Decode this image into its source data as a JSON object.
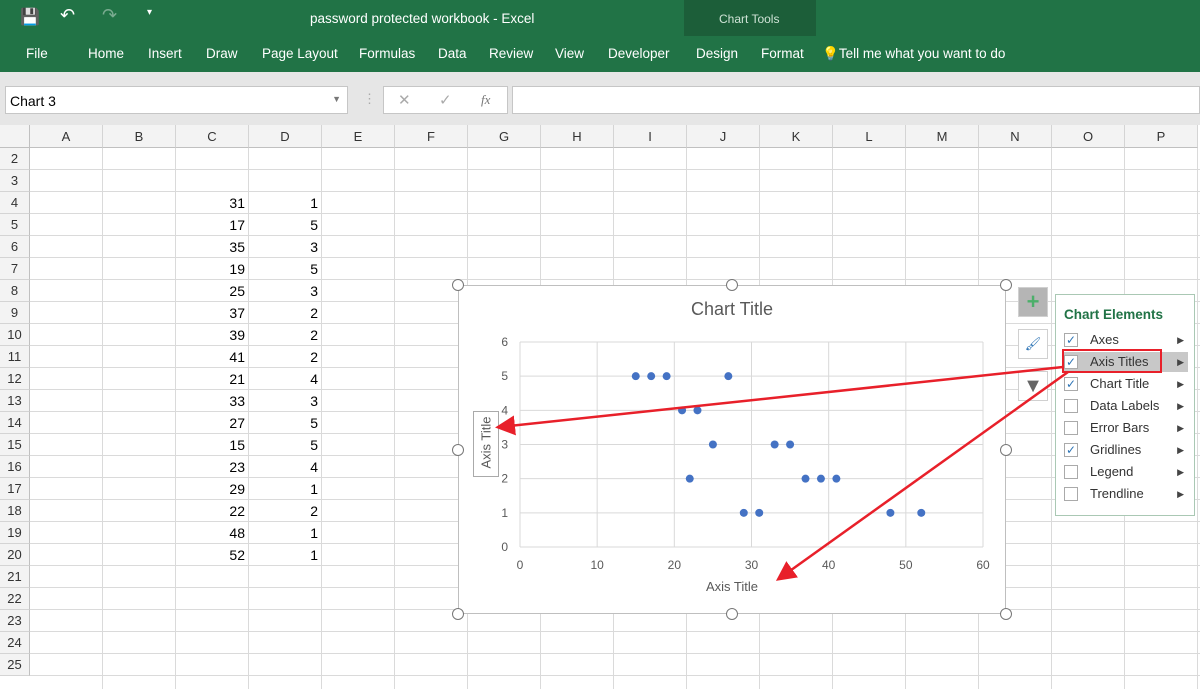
{
  "window": {
    "title": "password protected workbook  -  Excel",
    "context_group": "Chart Tools"
  },
  "ribbon": {
    "tabs": [
      "File",
      "Home",
      "Insert",
      "Draw",
      "Page Layout",
      "Formulas",
      "Data",
      "Review",
      "View",
      "Developer",
      "Design",
      "Format"
    ],
    "tell_me": "Tell me what you want to do"
  },
  "formula_bar": {
    "name_box": "Chart 3",
    "fx": "fx",
    "formula": ""
  },
  "columns": [
    "A",
    "B",
    "C",
    "D",
    "E",
    "F",
    "G",
    "H",
    "I",
    "J",
    "K",
    "L",
    "M",
    "N",
    "O",
    "P"
  ],
  "rows": [
    "2",
    "3",
    "4",
    "5",
    "6",
    "7",
    "8",
    "9",
    "10",
    "11",
    "12",
    "13",
    "14",
    "15",
    "16",
    "17",
    "18",
    "19",
    "20",
    "21",
    "22",
    "23",
    "24",
    "25"
  ],
  "cells": {
    "C": [
      31,
      17,
      35,
      19,
      25,
      37,
      39,
      41,
      21,
      33,
      27,
      15,
      23,
      29,
      22,
      48,
      52
    ],
    "D": [
      1,
      5,
      3,
      5,
      3,
      2,
      2,
      2,
      4,
      3,
      5,
      5,
      4,
      1,
      2,
      1,
      1
    ],
    "start_row": 4
  },
  "chart_data": {
    "type": "scatter",
    "title": "Chart Title",
    "xlabel": "Axis Title",
    "ylabel": "Axis Title",
    "xlim": [
      0,
      60
    ],
    "ylim": [
      0,
      6
    ],
    "xticks": [
      0,
      10,
      20,
      30,
      40,
      50,
      60
    ],
    "yticks": [
      0,
      1,
      2,
      3,
      4,
      5,
      6
    ],
    "grid": true,
    "color": "#4472c4",
    "x": [
      31,
      17,
      35,
      19,
      25,
      37,
      39,
      41,
      21,
      33,
      27,
      15,
      23,
      29,
      22,
      48,
      52
    ],
    "y": [
      1,
      5,
      3,
      5,
      3,
      2,
      2,
      2,
      4,
      3,
      5,
      5,
      4,
      1,
      2,
      1,
      1
    ]
  },
  "chart_elements": {
    "title": "Chart Elements",
    "items": [
      {
        "label": "Axes",
        "checked": true
      },
      {
        "label": "Axis Titles",
        "checked": true
      },
      {
        "label": "Chart Title",
        "checked": true
      },
      {
        "label": "Data Labels",
        "checked": false
      },
      {
        "label": "Error Bars",
        "checked": false
      },
      {
        "label": "Gridlines",
        "checked": true
      },
      {
        "label": "Legend",
        "checked": false
      },
      {
        "label": "Trendline",
        "checked": false
      }
    ]
  },
  "colors": {
    "ribbon": "#217346",
    "annotation": "#e8202a",
    "accent_text": "#217346"
  }
}
